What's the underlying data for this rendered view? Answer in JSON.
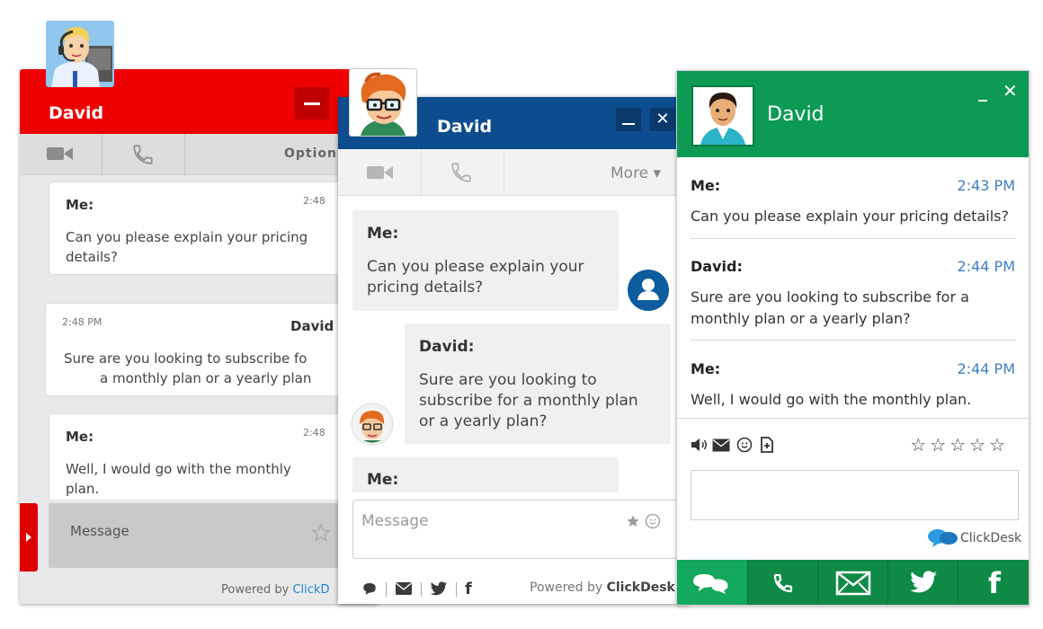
{
  "red_window": {
    "name": "David",
    "tool_options": "Option",
    "messages": [
      {
        "sender": "Me:",
        "time": "2:48",
        "text_lines": [
          "Can you please explain your pricing",
          "details?"
        ]
      },
      {
        "sender": "David",
        "time": "2:48 PM",
        "text_lines": [
          "Sure are you looking to subscribe fo",
          "a monthly plan or a yearly plan"
        ]
      },
      {
        "sender": "Me:",
        "time": "2:48",
        "text_lines": [
          "Well, I would go with the monthly",
          "plan."
        ]
      }
    ],
    "message_placeholder": "Message",
    "powered_prefix": "Powered by ",
    "powered_brand": "ClickD"
  },
  "blue_window": {
    "name": "David",
    "close_label": "✕",
    "tool_more": "More ▾",
    "messages": [
      {
        "sender": "Me:",
        "text_lines": [
          "Can you please explain your",
          "pricing details?"
        ]
      },
      {
        "sender": "David:",
        "text_lines": [
          "Sure are you looking to",
          "subscribe for a monthly plan",
          "or a yearly plan?"
        ]
      },
      {
        "sender": "Me:",
        "text_lines": []
      }
    ],
    "message_placeholder": "Message",
    "powered_prefix": "Powered by ",
    "powered_brand": "ClickDesk"
  },
  "green_window": {
    "name": "David",
    "min_label": "_",
    "close_label": "✕",
    "messages": [
      {
        "sender": "Me:",
        "time": "2:43 PM",
        "text_lines": [
          "Can you please explain your pricing details?"
        ]
      },
      {
        "sender": "David:",
        "time": "2:44 PM",
        "text_lines": [
          "Sure are you looking to subscribe for a",
          "monthly plan or a yearly plan?"
        ]
      },
      {
        "sender": "Me:",
        "time": "2:44 PM",
        "text_lines": [
          "Well, I would go with the monthly plan."
        ]
      }
    ],
    "rating_stars": "☆☆☆☆☆",
    "brand": "ClickDesk",
    "facebook_label": "f"
  },
  "colors": {
    "red_header": "#ee0000",
    "blue_header": "#0d4d8f",
    "green_header": "#0d9a55",
    "time_blue": "#3e7fc1"
  }
}
